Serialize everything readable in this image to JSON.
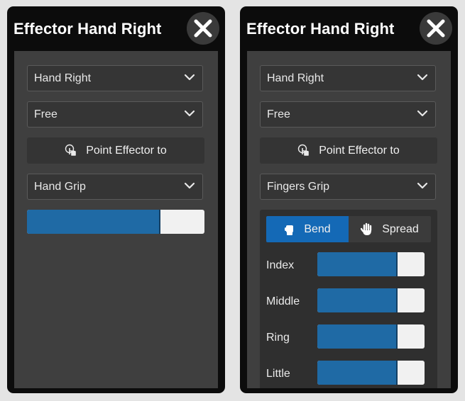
{
  "panels": [
    {
      "title": "Effector Hand Right",
      "close_icon": "close-icon",
      "dropdowns": [
        "Hand Right",
        "Free"
      ],
      "point_button": {
        "label": "Point Effector to",
        "icon": "hand-pointer-icon"
      },
      "grip_dropdown": "Hand Grip",
      "grip_slider": {
        "value": 0.75
      }
    },
    {
      "title": "Effector Hand Right",
      "close_icon": "close-icon",
      "dropdowns": [
        "Hand Right",
        "Free"
      ],
      "point_button": {
        "label": "Point Effector to",
        "icon": "hand-pointer-icon"
      },
      "grip_dropdown": "Fingers Grip",
      "fingers": {
        "modes": [
          {
            "label": "Bend",
            "icon": "fist-icon",
            "active": true
          },
          {
            "label": "Spread",
            "icon": "open-hand-icon",
            "active": false
          }
        ],
        "sliders": [
          {
            "label": "Index",
            "value": 0.75
          },
          {
            "label": "Middle",
            "value": 0.75
          },
          {
            "label": "Ring",
            "value": 0.75
          },
          {
            "label": "Little",
            "value": 0.75
          }
        ]
      }
    }
  ],
  "colors": {
    "accent": "#1f6aa5",
    "active_tab": "#1469b6",
    "panel_bg": "#3f3f3f",
    "header_bg": "#0c0c0c"
  }
}
